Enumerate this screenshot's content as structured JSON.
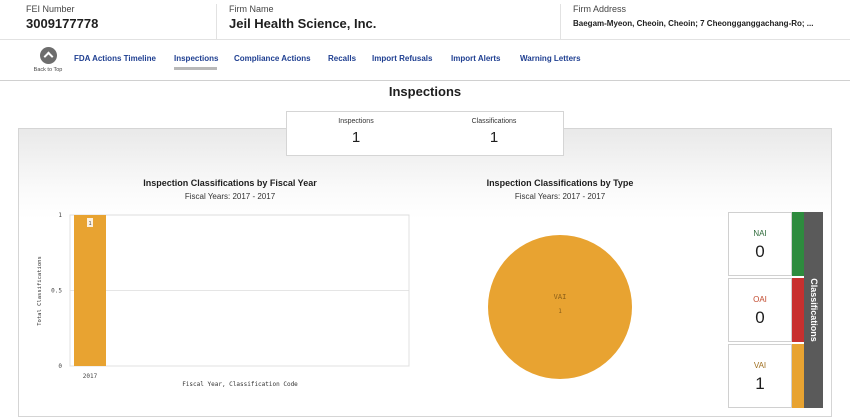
{
  "header": {
    "fei_label": "FEI Number",
    "fei_value": "3009177778",
    "firm_label": "Firm Name",
    "firm_value": "Jeil Health Science, Inc.",
    "address_label": "Firm Address",
    "address_value": "Baegam-Myeon, Cheoin, Cheoin; 7 Cheongganggachang-Ro; ..."
  },
  "nav": {
    "back_label": "Back to Top",
    "items": [
      "FDA Actions Timeline",
      "Inspections",
      "Compliance Actions",
      "Recalls",
      "Import Refusals",
      "Import Alerts",
      "Warning Letters"
    ],
    "active": "Inspections"
  },
  "page_title": "Inspections",
  "counts": {
    "inspections_label": "Inspections",
    "inspections_value": "1",
    "classifications_label": "Classifications",
    "classifications_value": "1"
  },
  "bar_chart": {
    "title": "Inspection Classifications by Fiscal Year",
    "subtitle": "Fiscal Years: 2017 - 2017"
  },
  "pie_chart": {
    "title": "Inspection Classifications by Type",
    "subtitle": "Fiscal Years: 2017 - 2017"
  },
  "legend": {
    "side_label": "Classifications",
    "items": [
      {
        "name": "NAI",
        "value": "0",
        "color": "#2e8b3e",
        "text_color": "#2e6b3a"
      },
      {
        "name": "OAI",
        "value": "0",
        "color": "#c8302f",
        "text_color": "#c24a2e"
      },
      {
        "name": "VAI",
        "value": "1",
        "color": "#e8a331",
        "text_color": "#a07020"
      }
    ]
  },
  "chart_data": [
    {
      "type": "bar",
      "categories": [
        "2017"
      ],
      "series": [
        {
          "values": [
            1
          ],
          "color": "#e8a331"
        }
      ],
      "data_labels": [
        "1"
      ],
      "xlabel": "Fiscal Year, Classification Code",
      "ylabel": "Total Classifications",
      "ylim": [
        0,
        1
      ],
      "yticks": [
        "0",
        "0.5",
        "1"
      ],
      "grid": true
    },
    {
      "type": "pie",
      "slices": [
        {
          "label": "VAI",
          "value": 1,
          "color": "#e8a331"
        }
      ]
    }
  ]
}
